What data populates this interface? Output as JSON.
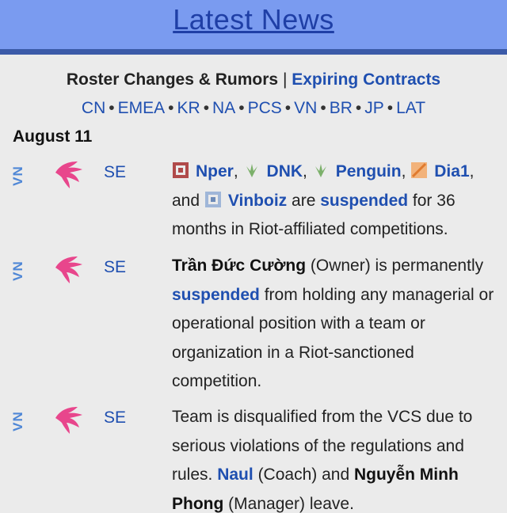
{
  "header": {
    "title": "Latest News"
  },
  "subnav": {
    "roster_label": "Roster Changes & Rumors",
    "separator": "|",
    "expiring_label": "Expiring Contracts"
  },
  "regions": [
    "CN",
    "EMEA",
    "KR",
    "NA",
    "PCS",
    "VN",
    "BR",
    "JP",
    "LAT"
  ],
  "region_separator": "•",
  "date": "August 11",
  "entries": [
    {
      "region": "VN",
      "role": "SE",
      "players": [
        "Nper",
        "DNK",
        "Penguin",
        "Dia1",
        "Vinboiz"
      ],
      "t_comma": ",",
      "t_and": "and",
      "t_are": "are",
      "suspended": "suspended",
      "t_tail": "for 36 months in Riot-affiliated competitions."
    },
    {
      "region": "VN",
      "role": "SE",
      "owner_name": "Trần Đức Cường",
      "owner_role": "(Owner) is permanently",
      "suspended": "suspended",
      "tail": "from holding any managerial or operational position with a team or organization in a Riot-sanctioned competition."
    },
    {
      "region": "VN",
      "role": "SE",
      "text_1": "Team is disqualified from the VCS due to serious violations of the regulations and rules.",
      "coach_name": "Naul",
      "coach_role": "(Coach) and",
      "manager_name": "Nguyễn Minh Phong",
      "manager_role": "(Manager) leave."
    }
  ],
  "colors": {
    "header_bg": "#7a9bf0",
    "header_bar": "#3b5aa8",
    "link": "#1f4fb0",
    "region_tag": "#4f87d6",
    "team_logo": "#e8468c"
  }
}
